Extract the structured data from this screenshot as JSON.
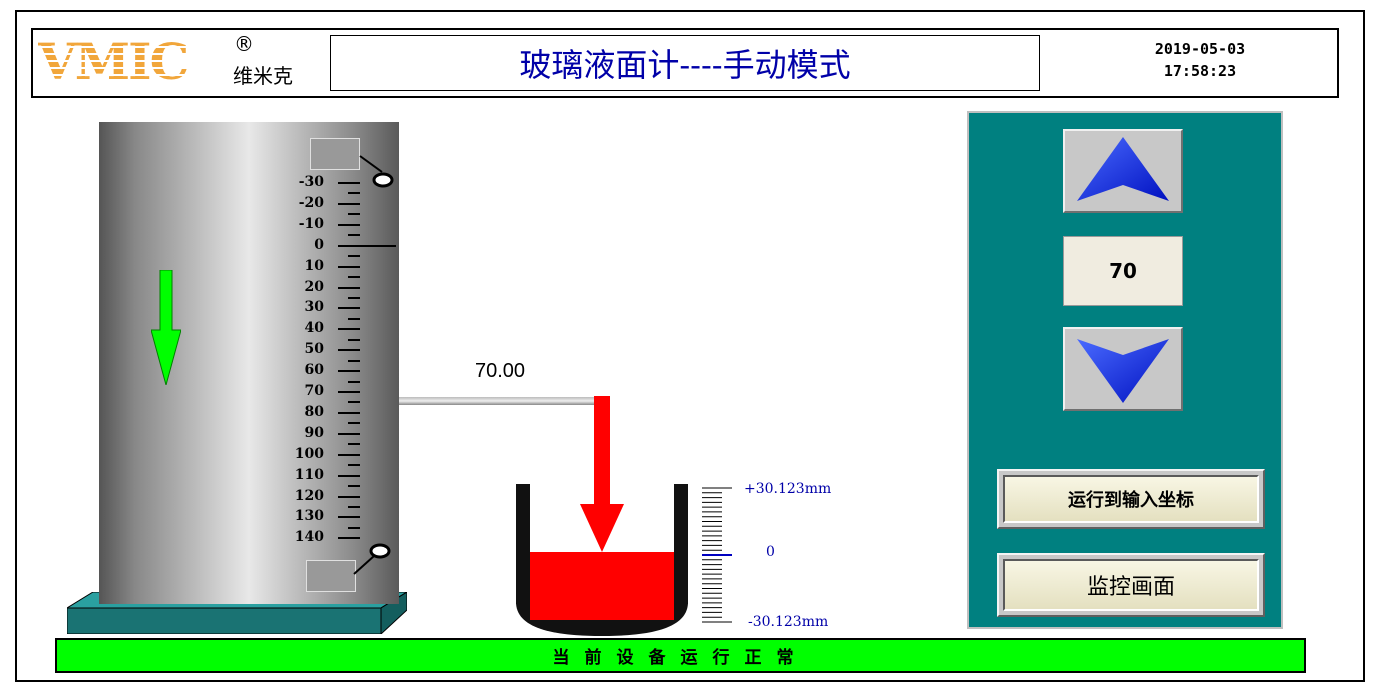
{
  "logo": {
    "brand": "VMIC",
    "registered": "®",
    "cn_name": "维米克"
  },
  "title": "玻璃液面计----手动模式",
  "datetime": {
    "date": "2019-05-03",
    "time": "17:58:23"
  },
  "scale": {
    "labels": [
      "-30",
      "-20",
      "-10",
      "0",
      "10",
      "20",
      "30",
      "40",
      "50",
      "60",
      "70",
      "80",
      "90",
      "100",
      "110",
      "120",
      "130",
      "140"
    ]
  },
  "current_value_label": "70.00",
  "level_fraction": 0.5,
  "gauge": {
    "top": "+30.123mm",
    "mid": "0",
    "bottom": "-30.123mm"
  },
  "panel": {
    "setpoint": "70",
    "run_to_button": "运行到输入坐标",
    "monitor_button": "监控画面"
  },
  "status": "当前设备运行正常",
  "colors": {
    "panel_bg": "#008080",
    "status_bg": "#00ff00",
    "liquid": "#ff0000",
    "arrow_down": "#00ff00",
    "title": "#0000a8"
  },
  "icons": {
    "up": "up-arrow-icon",
    "down": "down-arrow-icon",
    "direction": "down-arrow-green-icon"
  }
}
